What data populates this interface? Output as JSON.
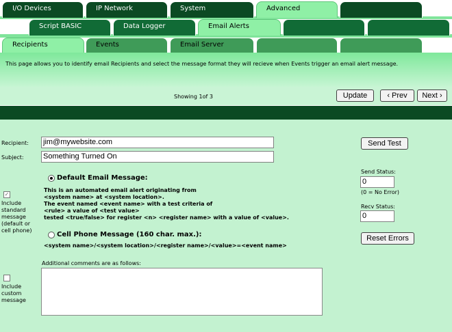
{
  "tabs_level1": [
    "I/O Devices",
    "IP Network",
    "System",
    "Advanced",
    ""
  ],
  "tabs_level2": [
    "Script BASIC",
    "Data Logger",
    "Email Alerts",
    "",
    ""
  ],
  "tabs_level3": [
    "Recipients",
    "Events",
    "Email Server",
    "",
    ""
  ],
  "description": "This page allows you to identify email Recipients and select the message format they will recieve when Events trigger an email alert message.",
  "nav": {
    "showing": "Showing 1of 3",
    "update": "Update",
    "prev": "‹ Prev",
    "next": "Next ›"
  },
  "form": {
    "recipient_label": "Recipient:",
    "recipient_value": "jim@mywebsite.com",
    "subject_label": "Subject:",
    "subject_value": "Something Turned On",
    "default_heading": "Default Email Message:",
    "default_lines": [
      "This is an automated email alert originating from",
      "<system name> at <system location>.",
      "The event named <event name> with a test criteria of",
      "<rule> a value of <test value>",
      "tested <true/false> for register <n> <register name> with a value of <value>."
    ],
    "cell_heading": "Cell Phone Message (160 char. max.):",
    "cell_line": "<system name>/<system location>/<register name>/<value>=<event name>",
    "include_standard_lines": [
      "Include",
      "standard",
      "message",
      "(default or",
      "cell phone)"
    ],
    "include_custom_lines": [
      "Include",
      "custom",
      "message"
    ],
    "additional_label": "Additional comments are as follows:",
    "send_test": "Send Test",
    "send_status_label": "Send Status:",
    "send_status_value": "0",
    "no_error_note": "(0 = No Error)",
    "recv_status_label": "Recv Status:",
    "recv_status_value": "0",
    "reset_errors": "Reset Errors"
  }
}
